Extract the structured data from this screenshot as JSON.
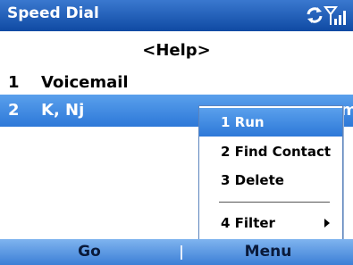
{
  "title_bar": {
    "title": "Speed Dial",
    "icons": [
      "connection-sync-icon",
      "signal-strength-icon"
    ]
  },
  "help": {
    "label": "<Help>"
  },
  "entries": [
    {
      "number": "1",
      "label": "Voicemail",
      "selected": false
    },
    {
      "number": "2",
      "label": "K, Nj",
      "selected": true,
      "overflow_text": "m"
    }
  ],
  "context_menu": {
    "items": [
      {
        "label": "1 Run",
        "active": true
      },
      {
        "label": "2 Find Contact",
        "active": false
      },
      {
        "label": "3 Delete",
        "active": false
      },
      {
        "label": "4 Filter",
        "active": false,
        "has_submenu": true
      }
    ]
  },
  "softkeys": {
    "left": "Go",
    "right": "Menu"
  },
  "colors": {
    "title_bar": "#1f5fbf",
    "selection": "#3a86e0",
    "softkey_bar": "#5a98e4"
  }
}
